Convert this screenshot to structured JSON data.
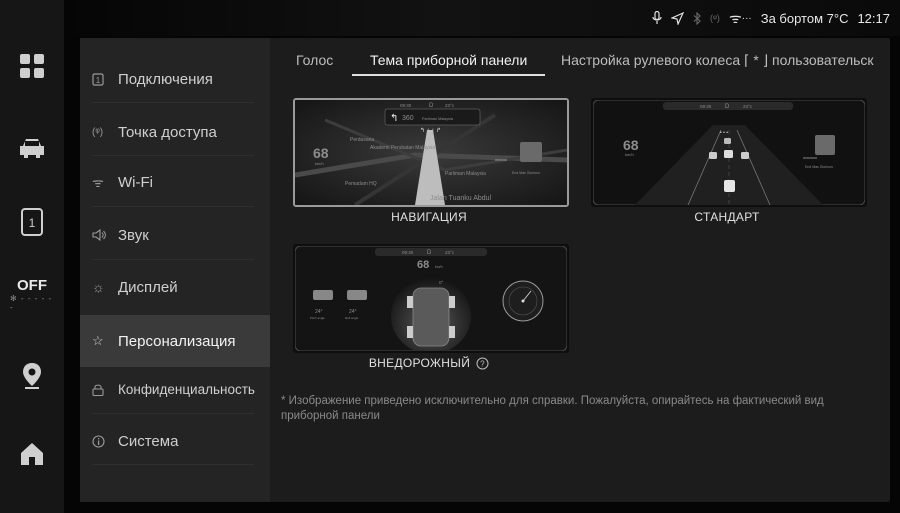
{
  "status": {
    "outside_temp": "За бортом 7°C",
    "time": "12:17",
    "icons": [
      "microphone-icon",
      "location-arrow-icon",
      "bluetooth-icon",
      "hotspot-icon",
      "wifi-icon"
    ]
  },
  "dock": {
    "items": [
      "apps-grid-icon",
      "car-icon",
      "phone-icon",
      "climate-off",
      "map-pin-icon",
      "home-icon"
    ],
    "climate_label": "OFF"
  },
  "sidebar": {
    "items": [
      {
        "label": "Подключения",
        "icon": "connections-icon"
      },
      {
        "label": "Точка доступа",
        "icon": "hotspot-icon"
      },
      {
        "label": "Wi-Fi",
        "icon": "wifi-icon"
      },
      {
        "label": "Звук",
        "icon": "speaker-icon"
      },
      {
        "label": "Дисплей",
        "icon": "brightness-icon"
      },
      {
        "label": "Персонализация",
        "icon": "personalization-icon",
        "active": true
      },
      {
        "label": "Конфиденциальность",
        "icon": "lock-icon"
      },
      {
        "label": "Система",
        "icon": "info-icon"
      }
    ]
  },
  "tabs": {
    "items": [
      "Голос",
      "Тема приборной панели",
      "Настройка рулевого колеса ⌈ * ⌋ пользовательск"
    ],
    "active_index": 1
  },
  "themes": [
    {
      "caption": "НАВИГАЦИЯ",
      "selected": true,
      "preview": {
        "time": "09:30",
        "gear": "D",
        "temp": "23°c",
        "speed": "68",
        "unit": "km/h",
        "distance": "360",
        "street1": "Perdasana",
        "street2": "Akademi Perubatan Malaysia",
        "street3": "Parliman Malaysia",
        "street4": "Pemadam HQ",
        "street5": "Jalan Tuanku Abdul",
        "next_road": "Parliman Malaysia",
        "media": "End Mas Glorious"
      }
    },
    {
      "caption": "СТАНДАРТ",
      "selected": false,
      "preview": {
        "time": "09:30",
        "gear": "D",
        "temp": "23°c",
        "speed": "68",
        "unit": "km/h",
        "media": "End Mas Glorious"
      }
    },
    {
      "caption": "ВНЕДОРОЖНЫЙ",
      "selected": false,
      "help_icon": "question-circle-icon",
      "preview": {
        "time": "09:30",
        "gear": "D",
        "temp": "23°c",
        "speed": "68",
        "unit": "km/h",
        "pitch": "24°",
        "roll": "24°",
        "pitch_label": "Pitch angle",
        "roll_label": "Roll angle",
        "tilt": "0°"
      }
    }
  ],
  "note": "* Изображение приведено исключительно для справки. Пожалуйста, опирайтесь на фактический вид приборной панели"
}
